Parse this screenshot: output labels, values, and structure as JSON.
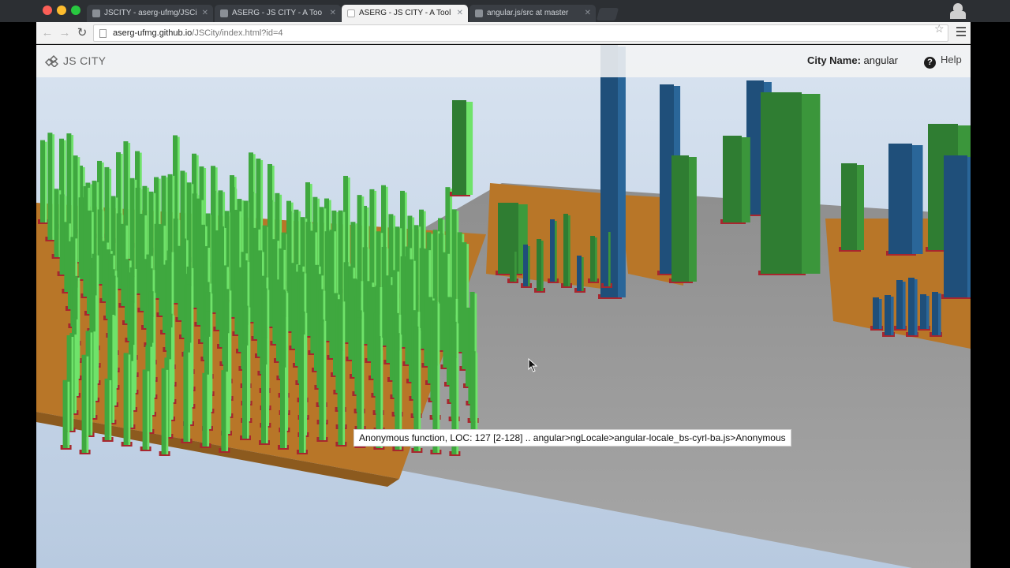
{
  "browser": {
    "tabs": [
      {
        "title": "JSCITY - aserg-ufmg/JSCi",
        "active": false
      },
      {
        "title": "ASERG - JS CITY - A Too",
        "active": false
      },
      {
        "title": "ASERG - JS CITY - A Tool",
        "active": true
      },
      {
        "title": "angular.js/src at master",
        "active": false
      }
    ],
    "url_host": "aserg-ufmg.github.io",
    "url_path": "/JSCity/index.html?id=4"
  },
  "app": {
    "brand": "JS CITY",
    "city_label": "City Name:",
    "city_value": "angular",
    "help_label": "Help"
  },
  "tooltip": {
    "text": "Anonymous function, LOC: 127 [2-128] .. angular>ngLocale>angular-locale_bs-cyrl-ba.js>Anonymous"
  },
  "colors": {
    "function_building": "#2f7d32",
    "highlight_building": "#6fe36a",
    "variable_building": "#1f4f7a",
    "district_base": "#b5762a",
    "building_base": "#a8262e",
    "ground": "#8d8d8d",
    "sky_top": "#d4e0ee"
  }
}
